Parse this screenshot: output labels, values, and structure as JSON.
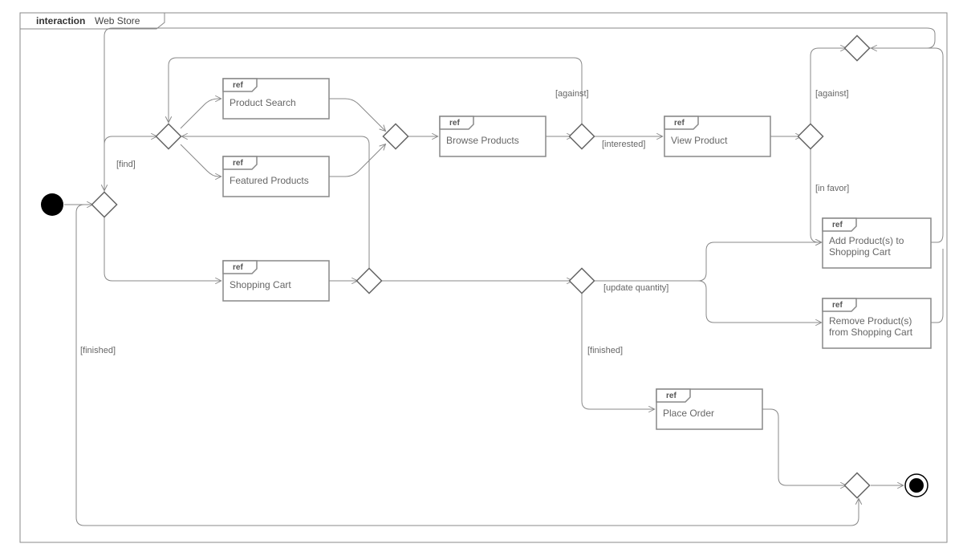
{
  "frame": {
    "keyword": "interaction",
    "name": "Web Store"
  },
  "refs": {
    "product_search": "Product Search",
    "featured_products": "Featured Products",
    "browse_products": "Browse Products",
    "view_product": "View Product",
    "add_to_cart": "Add Product(s) to\nShopping Cart",
    "remove_from_cart": "Remove Product(s)\nfrom Shopping Cart",
    "shopping_cart": "Shopping Cart",
    "place_order": "Place Order"
  },
  "ref_keyword": "ref",
  "guards": {
    "find": "[find]",
    "finished_left": "[finished]",
    "against_top": "[against]",
    "interested": "[interested]",
    "against_right": "[against]",
    "in_favor": "[in favor]",
    "update_quantity": "[update quantity]",
    "finished_mid": "[finished]"
  },
  "chart_data": {
    "type": "uml-interaction-overview",
    "frame": {
      "keyword": "interaction",
      "name": "Web Store"
    },
    "nodes": [
      {
        "id": "initial",
        "kind": "initial"
      },
      {
        "id": "d_main",
        "kind": "decision"
      },
      {
        "id": "d_find",
        "kind": "decision"
      },
      {
        "id": "ref_search",
        "kind": "ref",
        "label": "Product Search"
      },
      {
        "id": "ref_featured",
        "kind": "ref",
        "label": "Featured Products"
      },
      {
        "id": "m_search_featured",
        "kind": "merge"
      },
      {
        "id": "ref_browse",
        "kind": "ref",
        "label": "Browse Products"
      },
      {
        "id": "d_after_browse",
        "kind": "decision"
      },
      {
        "id": "ref_view",
        "kind": "ref",
        "label": "View Product"
      },
      {
        "id": "d_after_view",
        "kind": "decision"
      },
      {
        "id": "ref_add",
        "kind": "ref",
        "label": "Add Product(s) to Shopping Cart"
      },
      {
        "id": "ref_remove",
        "kind": "ref",
        "label": "Remove Product(s) from Shopping Cart"
      },
      {
        "id": "m_top",
        "kind": "merge"
      },
      {
        "id": "ref_cart",
        "kind": "ref",
        "label": "Shopping Cart"
      },
      {
        "id": "d_cart1",
        "kind": "decision"
      },
      {
        "id": "d_cart2",
        "kind": "decision"
      },
      {
        "id": "ref_order",
        "kind": "ref",
        "label": "Place Order"
      },
      {
        "id": "d_end",
        "kind": "decision"
      },
      {
        "id": "final",
        "kind": "final"
      }
    ],
    "edges": [
      {
        "from": "initial",
        "to": "d_main"
      },
      {
        "from": "d_main",
        "to": "d_find",
        "guard": "find"
      },
      {
        "from": "d_find",
        "to": "ref_search"
      },
      {
        "from": "d_find",
        "to": "ref_featured"
      },
      {
        "from": "ref_search",
        "to": "m_search_featured"
      },
      {
        "from": "ref_featured",
        "to": "m_search_featured"
      },
      {
        "from": "m_search_featured",
        "to": "ref_browse"
      },
      {
        "from": "ref_browse",
        "to": "d_after_browse"
      },
      {
        "from": "d_after_browse",
        "to": "d_find",
        "guard": "against"
      },
      {
        "from": "d_after_browse",
        "to": "ref_view",
        "guard": "interested"
      },
      {
        "from": "ref_view",
        "to": "d_after_view"
      },
      {
        "from": "d_after_view",
        "to": "m_top",
        "guard": "against"
      },
      {
        "from": "d_after_view",
        "to": "ref_add",
        "guard": "in favor"
      },
      {
        "from": "ref_add",
        "to": "m_top"
      },
      {
        "from": "m_top",
        "to": "d_main"
      },
      {
        "from": "d_main",
        "to": "ref_cart"
      },
      {
        "from": "ref_cart",
        "to": "d_cart1"
      },
      {
        "from": "d_cart1",
        "to": "d_cart2"
      },
      {
        "from": "d_cart2",
        "to": "ref_add",
        "guard": "update quantity"
      },
      {
        "from": "d_cart2",
        "to": "ref_remove",
        "guard": "update quantity"
      },
      {
        "from": "ref_remove",
        "to": "m_top"
      },
      {
        "from": "d_cart2",
        "to": "ref_order",
        "guard": "finished"
      },
      {
        "from": "d_cart1",
        "to": "d_find"
      },
      {
        "from": "ref_order",
        "to": "d_end"
      },
      {
        "from": "d_main",
        "to": "d_end",
        "guard": "finished"
      },
      {
        "from": "d_end",
        "to": "final"
      }
    ]
  }
}
